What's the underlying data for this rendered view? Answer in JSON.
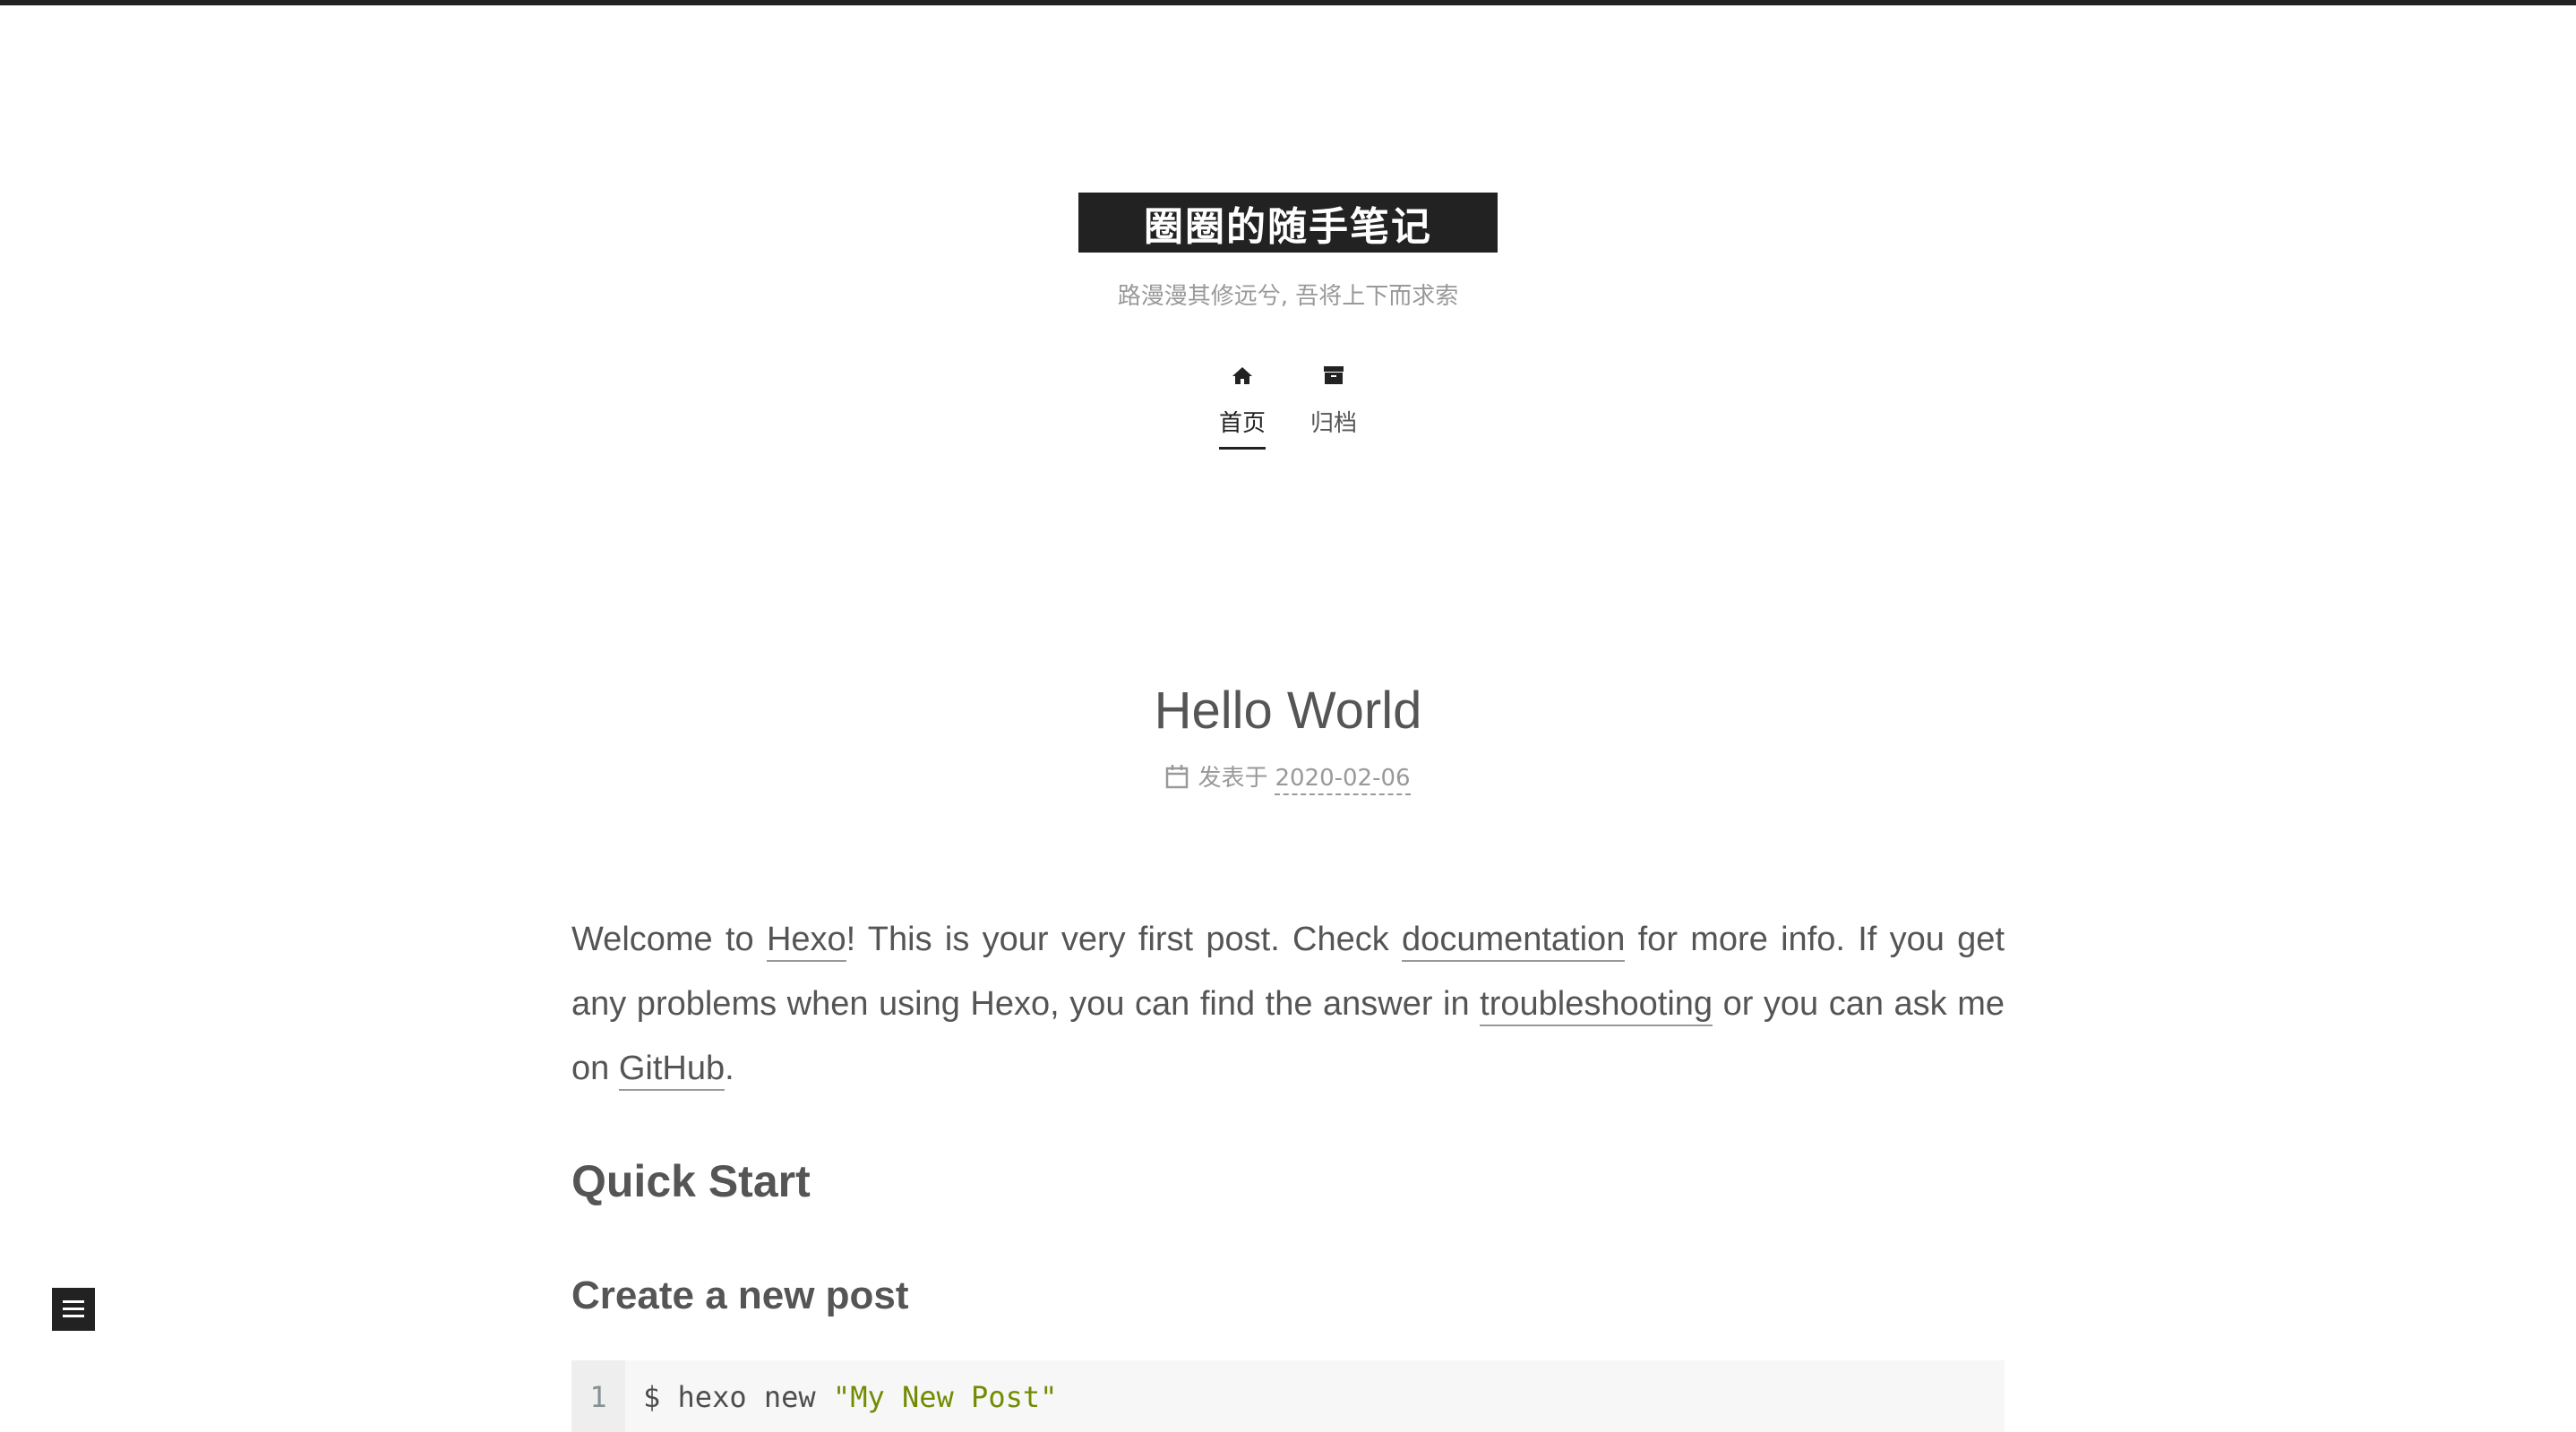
{
  "site": {
    "title": "圈圈的随手笔记",
    "subtitle": "路漫漫其修远兮, 吾将上下而求索"
  },
  "nav": {
    "items": [
      {
        "label": "首页",
        "icon": "home-icon",
        "active": true
      },
      {
        "label": "归档",
        "icon": "archive-icon",
        "active": false
      }
    ]
  },
  "post": {
    "title": "Hello World",
    "meta_label": "发表于",
    "date": "2020-02-06",
    "intro": {
      "t1": "Welcome to ",
      "link_hexo": "Hexo",
      "t2": "! This is your very first post. Check ",
      "link_docs": "documentation",
      "t3": " for more info. If you get any problems when using Hexo, you can find the answer in ",
      "link_trouble": "troubleshooting",
      "t4": " or you can ask me on ",
      "link_github": "GitHub",
      "t5": "."
    },
    "h2": "Quick Start",
    "h3": "Create a new post",
    "code": {
      "line_number": "1",
      "prefix": "$ hexo new ",
      "string": "\"My New Post\""
    }
  },
  "colors": {
    "accent": "#222222",
    "text": "#555555",
    "muted": "#999999",
    "code_string": "#718c00"
  }
}
